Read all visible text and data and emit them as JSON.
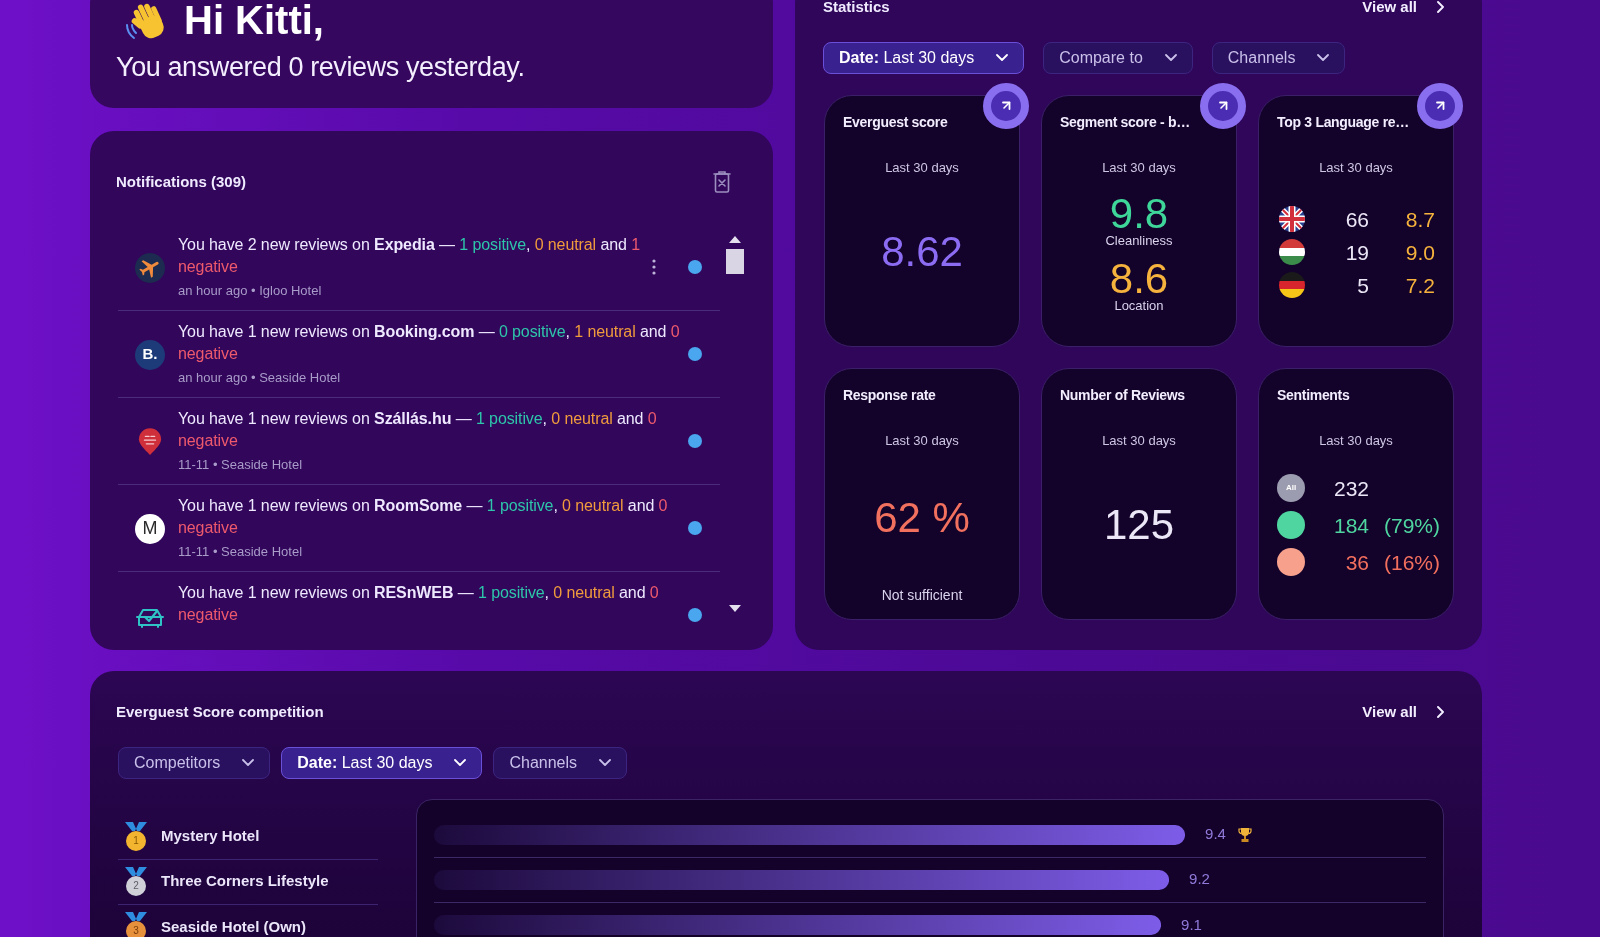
{
  "greeting": {
    "title": "Hi Kitti,",
    "subtitle": "You answered 0 reviews yesterday."
  },
  "notifications": {
    "title": "Notifications (309)",
    "items": [
      {
        "kind": "plane",
        "message": {
          "lead": "You have 2 new reviews on **Expedia** —",
          "positive": "1 positive",
          "separator": ",",
          "neutral": "0 neutral",
          "conjunction": "and",
          "negative": "1 negative"
        },
        "meta": "an hour ago • Igloo Hotel",
        "unread": true,
        "hovered": true
      },
      {
        "kind": "letter",
        "logo_text": "B.",
        "message": {
          "lead": "You have 1 new reviews on **Booking.com** —",
          "positive": "0 positive",
          "separator": ",",
          "neutral": "1 neutral",
          "conjunction": "and",
          "negative": "0 negative"
        },
        "meta": "an hour ago • Seaside Hotel",
        "unread": true,
        "hovered": false
      },
      {
        "kind": "pin",
        "message": {
          "lead": "You have 1 new reviews on **Szállás.hu** —",
          "positive": "1 positive",
          "separator": ",",
          "neutral": "0 neutral",
          "conjunction": "and",
          "negative": "0 negative"
        },
        "meta": "11-11 • Seaside Hotel",
        "unread": true,
        "hovered": false
      },
      {
        "kind": "monogram",
        "logo_text": "M",
        "message": {
          "lead": "You have 1 new reviews on **RoomSome** —",
          "positive": "1 positive",
          "separator": ",",
          "neutral": "0 neutral",
          "conjunction": "and",
          "negative": "0 negative"
        },
        "meta": "11-11 • Seaside Hotel",
        "unread": true,
        "hovered": false
      },
      {
        "kind": "car",
        "message": {
          "lead": "You have 1 new reviews on **RESnWEB** —",
          "positive": "1 positive",
          "separator": ",",
          "neutral": "0 neutral",
          "conjunction": "and",
          "negative": "0 negative"
        },
        "unread": true,
        "hovered": false
      }
    ]
  },
  "statistics": {
    "title": "Statistics",
    "view_all": "View all",
    "filters": [
      {
        "label": "**Date:** Last 30 days",
        "active": true
      },
      {
        "label": "Compare to",
        "active": false
      },
      {
        "label": "Channels",
        "active": false
      }
    ],
    "cards": [
      {
        "kind": "value",
        "title": "Everguest score",
        "period": "Last 30 days",
        "value": "8.62",
        "color": "#8c6cf2",
        "expandable": true
      },
      {
        "kind": "segments",
        "title": "Segment score - b…",
        "period": "Last 30 days",
        "expandable": true,
        "segments": [
          {
            "value": "9.8",
            "label": "Cleanliness",
            "color": "#3fd69a"
          },
          {
            "value": "8.6",
            "label": "Location",
            "color": "#f5b23c"
          }
        ]
      },
      {
        "kind": "languages",
        "title": "Top 3 Language re…",
        "period": "Last 30 days",
        "expandable": true,
        "rows": [
          {
            "kind": "uk",
            "count": "66",
            "score": "8.7"
          },
          {
            "kind": "hu",
            "count": "19",
            "score": "9.0"
          },
          {
            "kind": "de",
            "count": "5",
            "score": "7.2"
          }
        ]
      },
      {
        "kind": "value",
        "title": "Response rate",
        "period": "Last 30 days",
        "value": "62 %",
        "color": "#f2705e",
        "footer": "Not sufficient",
        "expandable": false
      },
      {
        "kind": "value",
        "title": "Number of Reviews",
        "period": "Last 30 days",
        "value": "125",
        "color": "#ebe7f6",
        "expandable": false
      },
      {
        "kind": "sentiments",
        "title": "Sentiments",
        "period": "Last 30 days",
        "expandable": false,
        "rows": [
          {
            "kind": "all",
            "badge": "All",
            "count": "232"
          },
          {
            "kind": "positive",
            "count": "184",
            "share": "(79%)"
          },
          {
            "kind": "negative",
            "count": "36",
            "share": "(16%)"
          }
        ]
      }
    ]
  },
  "competition": {
    "title": "Everguest Score competition",
    "view_all": "View all",
    "filters": [
      {
        "label": "Competitors",
        "active": false
      },
      {
        "label": "**Date:** Last 30 days",
        "active": true
      },
      {
        "label": "Channels",
        "active": false
      }
    ],
    "medals": [
      {
        "kind": "gold",
        "label": "1"
      },
      {
        "kind": "silver",
        "label": "2"
      },
      {
        "kind": "bronze",
        "label": "3"
      }
    ],
    "chart_data": [
      {
        "type": "bar",
        "orientation": "horizontal",
        "categories": [
          "Mystery Hotel",
          "Three Corners Lifestyle",
          "Seaside Hotel (Own)"
        ],
        "values": [
          9.4,
          9.2,
          9.1
        ],
        "data_labels": true
      }
    ]
  }
}
